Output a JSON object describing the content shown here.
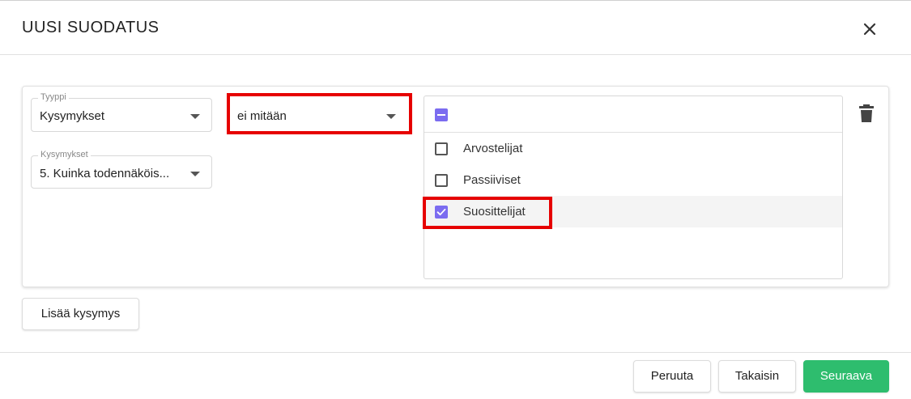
{
  "dialog": {
    "title": "UUSI SUODATUS",
    "close_icon": "close-icon"
  },
  "filter": {
    "type_field": {
      "label": "Tyyppi",
      "value": "Kysymykset"
    },
    "question_field": {
      "label": "Kysymykset",
      "value": "5. Kuinka todennäköis..."
    },
    "operator_field": {
      "value": "ei mitään"
    },
    "options": {
      "select_all_state": "indeterminate",
      "items": [
        {
          "label": "Arvostelijat",
          "checked": false
        },
        {
          "label": "Passiiviset",
          "checked": false
        },
        {
          "label": "Suosittelijat",
          "checked": true
        }
      ]
    },
    "delete_icon": "trash-icon"
  },
  "add_question_label": "Lisää kysymys",
  "footer": {
    "cancel_label": "Peruuta",
    "back_label": "Takaisin",
    "next_label": "Seuraava"
  },
  "colors": {
    "accent": "#7b6cf0",
    "primary_button": "#2ebd6e",
    "highlight": "#e60000"
  }
}
